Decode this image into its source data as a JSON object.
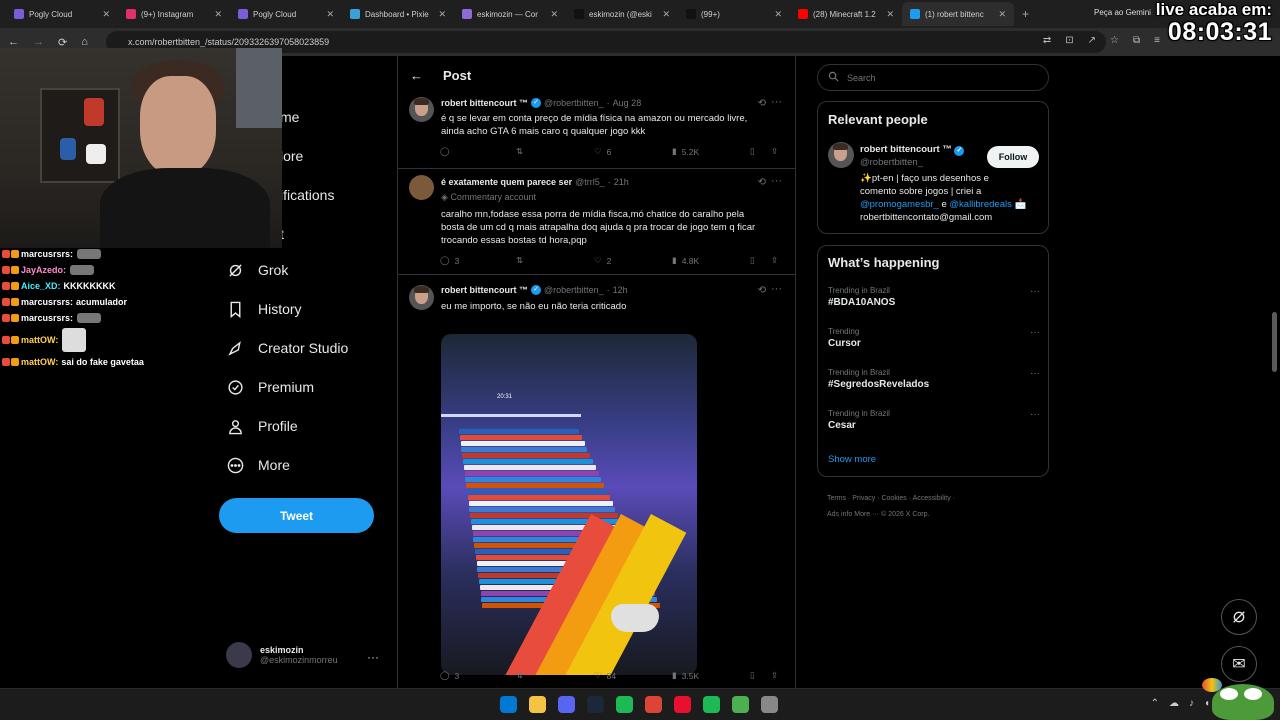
{
  "browser": {
    "tabs": [
      {
        "title": "Pogly Cloud",
        "color": "#7b5cd6"
      },
      {
        "title": "(9+) Instagram",
        "color": "#e1306c"
      },
      {
        "title": "Pogly Cloud",
        "color": "#7b5cd6"
      },
      {
        "title": "Dashboard • Pixie",
        "color": "#3aa0d8"
      },
      {
        "title": "eskimozin — Cor",
        "color": "#8c6bd8"
      },
      {
        "title": "eskimozin (@eski",
        "color": "#111111"
      },
      {
        "title": "(99+)",
        "color": "#111111"
      },
      {
        "title": "(28) Minecraft 1.2",
        "color": "#ff0000"
      },
      {
        "title": "(1) robert bittenc",
        "color": "#1d9bf0"
      }
    ],
    "new_tab": "+",
    "gemini_label": "Peça ao Gemini",
    "url": "x.com/robertbitten_/status/2093326397058023859"
  },
  "stream_overlay": {
    "timer_label": "live acaba em:",
    "timer_value": "08:03:31"
  },
  "chat": [
    {
      "user": "marcusrsrs:",
      "color": "#ffffff",
      "msg": "",
      "emote": true
    },
    {
      "user": "JayAzedo:",
      "color": "#ff8ccf",
      "msg": "",
      "emote": true
    },
    {
      "user": "Aice_XD:",
      "color": "#3ff0ff",
      "msg": "KKKKKKKK",
      "emote": false
    },
    {
      "user": "marcusrsrs:",
      "color": "#ffffff",
      "msg": "acumulador",
      "emote": false
    },
    {
      "user": "marcusrsrs:",
      "color": "#ffffff",
      "msg": "",
      "emote": true
    },
    {
      "user": "mattOW:",
      "color": "#ffd24d",
      "msg": "",
      "emote": true,
      "tall": true
    },
    {
      "user": "mattOW:",
      "color": "#ffd24d",
      "msg": "sai do fake gavetaa",
      "emote": false
    }
  ],
  "left_nav": {
    "partial_items": [
      "me",
      "lore",
      "ifications",
      "t"
    ],
    "items": [
      {
        "label": "Grok",
        "icon": "grok-icon"
      },
      {
        "label": "History",
        "icon": "bookmark-icon"
      },
      {
        "label": "Creator Studio",
        "icon": "rocket-icon"
      },
      {
        "label": "Premium",
        "icon": "verified-badge-icon"
      },
      {
        "label": "Profile",
        "icon": "person-icon"
      },
      {
        "label": "More",
        "icon": "more-circle-icon"
      }
    ],
    "tweet_button": "Tweet",
    "account": {
      "name": "eskimozin",
      "handle": "@eskimozinmorreu"
    }
  },
  "main": {
    "header_title": "Post",
    "tweets": [
      {
        "name": "robert bittencourt ™",
        "handle": "@robertbitten_",
        "time": "Aug 28",
        "text": "é q se levar em conta preço de mídia física na amazon ou mercado livre,\nainda acho GTA 6 mais caro q qualquer jogo kkk",
        "replies": "",
        "retweets": "",
        "likes": "6",
        "views": "5.2K",
        "verified": true
      },
      {
        "name": "é exatamente quem parece ser",
        "handle": "@trrl5_",
        "time": "21h",
        "commentary": "Commentary account",
        "text": "caralho mn,fodase essa porra de mídia fisca,mó chatice do caralho pela\nbosta de um cd q mais atrapalha doq ajuda q pra trocar de jogo tem q ficar\ntrocando essas bostas td hora,pqp",
        "replies": "3",
        "retweets": "",
        "likes": "2",
        "views": "4.8K",
        "verified": false
      },
      {
        "name": "robert bittencourt ™",
        "handle": "@robertbitten_",
        "time": "12h",
        "text": "eu me importo, se não eu não teria criticado",
        "replies": "3",
        "retweets": "",
        "likes": "84",
        "views": "3.5K",
        "verified": true,
        "media_screen_text": "20:31"
      }
    ]
  },
  "right": {
    "search_placeholder": "Search",
    "relevant_title": "Relevant people",
    "person": {
      "name": "robert bittencourt ™",
      "handle": "@robertbitten_",
      "follow": "Follow",
      "bio_line1": "✨pt-en | faço uns desenhos e",
      "bio_line2": "comento sobre jogos | criei a",
      "bio_mention1": "@promogamesbr_",
      "bio_and": " e ",
      "bio_mention2": "@kallibredeals",
      "bio_emoji": " 📩",
      "bio_email": "robertbittencontato@gmail.com"
    },
    "happening_title": "What’s happening",
    "trends": [
      {
        "context": "Trending in Brazil",
        "name": "#BDA10ANOS"
      },
      {
        "context": "Trending",
        "name": "Cursor"
      },
      {
        "context": "Trending in Brazil",
        "name": "#SegredosRevelados"
      },
      {
        "context": "Trending in Brazil",
        "name": "Cesar"
      }
    ],
    "show_more": "Show more",
    "footer": [
      "Terms",
      "Privacy",
      "Cookies",
      "Accessibility",
      "Ads info",
      "More ···",
      "© 2026 X Corp."
    ]
  },
  "taskbar_colors": [
    "#0078d4",
    "#f5c343",
    "#5865f2",
    "#1b2838",
    "#1db954",
    "#db4437",
    "#e8112d",
    "#1db954",
    "#4caf50",
    "#888888"
  ]
}
